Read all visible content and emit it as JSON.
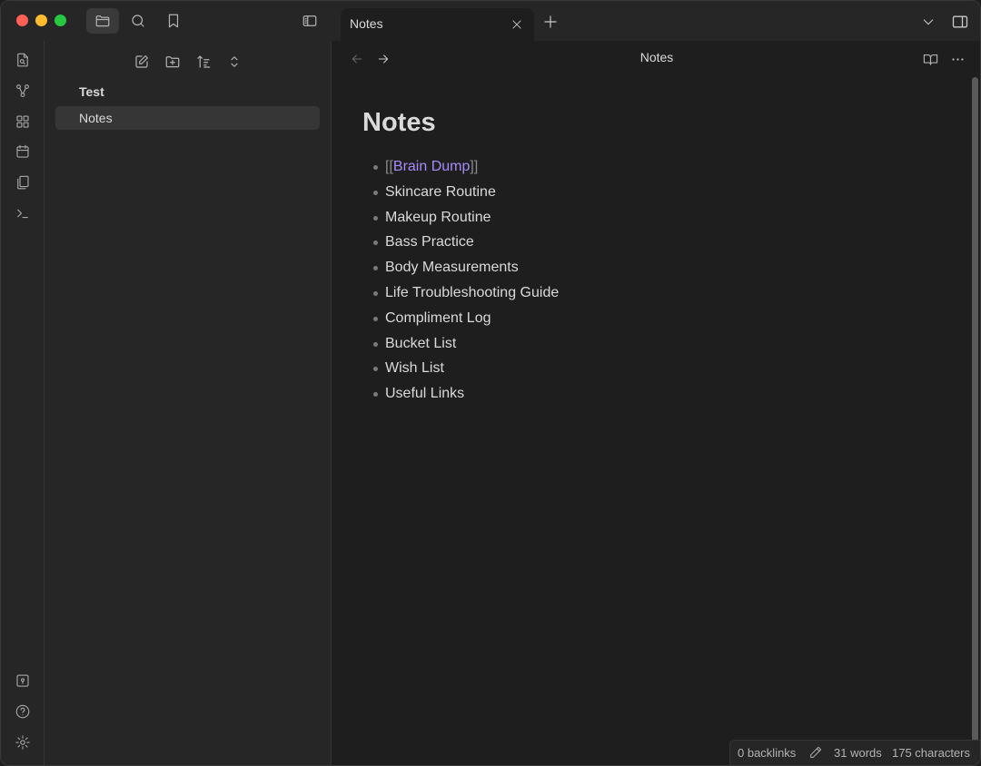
{
  "tab": {
    "title": "Notes"
  },
  "view": {
    "title": "Notes"
  },
  "file_tree": [
    {
      "label": "Test",
      "bold": true
    },
    {
      "label": "Notes",
      "selected": true
    }
  ],
  "note": {
    "title": "Notes",
    "link": {
      "open": "[[",
      "text": "Brain Dump",
      "close": "]]"
    },
    "items": [
      "Skincare Routine",
      "Makeup Routine",
      "Bass Practice",
      "Body Measurements",
      "Life Troubleshooting Guide",
      "Compliment Log",
      "Bucket List",
      "Wish List",
      "Useful Links"
    ]
  },
  "status": {
    "backlinks": "0 backlinks",
    "words": "31 words",
    "characters": "175 characters"
  },
  "icons": {
    "titlebar": [
      "folder-icon",
      "search-icon",
      "bookmark-icon",
      "sidebar-toggle-icon"
    ],
    "ribbon": [
      "open-quick-switcher-icon",
      "graph-view-icon",
      "canvas-icon",
      "daily-note-icon",
      "templates-icon",
      "command-palette-icon",
      "vault-icon",
      "help-icon",
      "settings-icon"
    ],
    "sidebar_toolbar": [
      "new-note-icon",
      "new-folder-icon",
      "sort-icon",
      "collapse-icon"
    ]
  },
  "colors": {
    "accent_link": "#a88bfa",
    "background": "#1e1e1e",
    "panel": "#262626"
  }
}
